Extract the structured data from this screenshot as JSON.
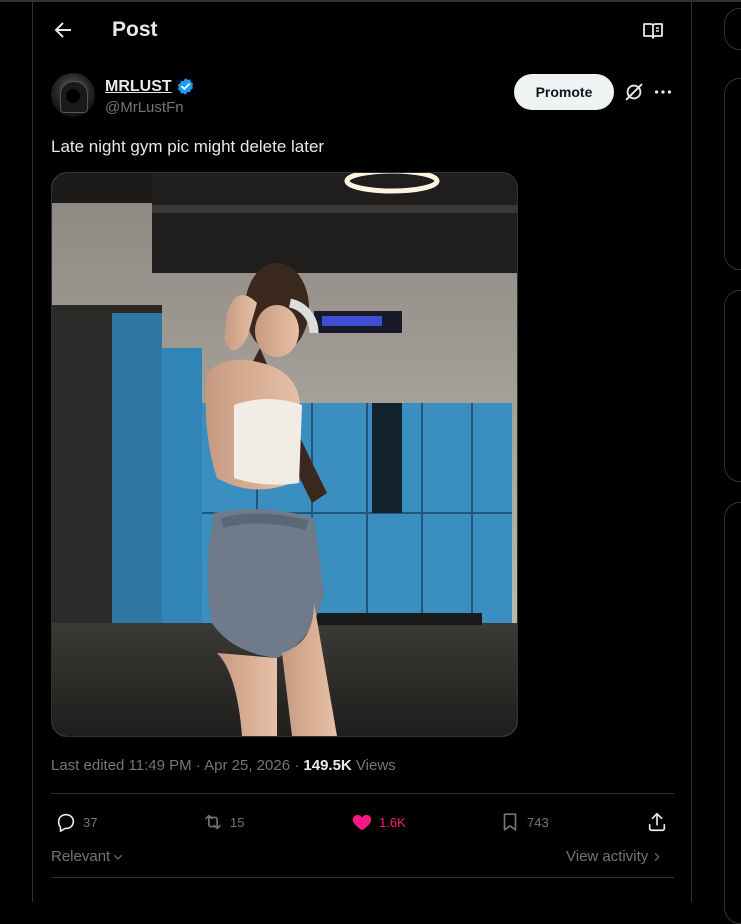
{
  "header": {
    "title": "Post"
  },
  "post": {
    "author_name": "MRLUST",
    "author_handle": "@MrLustFn",
    "promote_label": "Promote",
    "text": "Late night gym pic might delete later",
    "meta": {
      "edited": "Last edited 11:49 PM · Apr 25, 2026 · ",
      "views_count": "149.5K",
      "views_label": " Views"
    },
    "actions": {
      "replies": "37",
      "reposts": "15",
      "likes": "1.6K",
      "bookmarks": "743"
    },
    "sort_label": "Relevant",
    "view_activity_label": "View activity"
  },
  "colors": {
    "background": "#000000",
    "text": "#e7e9ea",
    "muted": "#71767b",
    "border": "#2f3336",
    "verified": "#1d9bf0",
    "like": "#f91880"
  },
  "icons": {
    "back": "arrow-left-icon",
    "reader": "reader-mode-icon",
    "verified": "verified-badge-icon",
    "grok": "grok-icon",
    "more": "more-horizontal-icon",
    "reply": "reply-icon",
    "repost": "repost-icon",
    "like": "heart-filled-icon",
    "bookmark": "bookmark-icon",
    "share": "share-icon"
  }
}
